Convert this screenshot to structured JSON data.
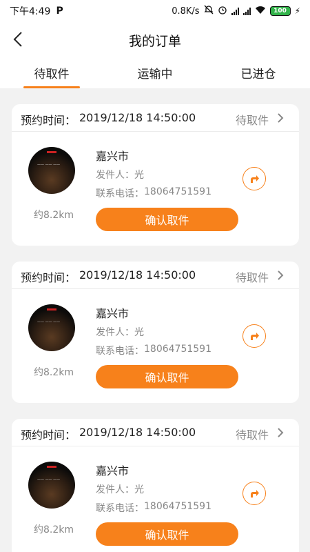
{
  "status_bar": {
    "time": "下午4:49",
    "p_icon": "P",
    "speed": "0.8K/s",
    "battery": "100",
    "icons": [
      "alarm-mute-icon",
      "alarm-icon",
      "signal-icon",
      "signal-icon",
      "wifi-icon",
      "battery-icon",
      "charging-icon"
    ]
  },
  "header": {
    "title": "我的订单",
    "back_icon": "back-arrow-icon"
  },
  "tabs": [
    {
      "label": "待取件",
      "active": true
    },
    {
      "label": "运输中",
      "active": false
    },
    {
      "label": "已进仓",
      "active": false
    }
  ],
  "orders": [
    {
      "appt_label": "预约时间：",
      "appt_time": "2019/12/18 14:50:00",
      "status": "待取件",
      "city": "嘉兴市",
      "sender_label": "发件人：",
      "sender": "光",
      "phone_label": "联系电话：",
      "phone": "18064751591",
      "distance": "约8.2km",
      "confirm_label": "确认取件"
    },
    {
      "appt_label": "预约时间：",
      "appt_time": "2019/12/18 14:50:00",
      "status": "待取件",
      "city": "嘉兴市",
      "sender_label": "发件人：",
      "sender": "光",
      "phone_label": "联系电话：",
      "phone": "18064751591",
      "distance": "约8.2km",
      "confirm_label": "确认取件"
    },
    {
      "appt_label": "预约时间：",
      "appt_time": "2019/12/18 14:50:00",
      "status": "待取件",
      "city": "嘉兴市",
      "sender_label": "发件人：",
      "sender": "光",
      "phone_label": "联系电话：",
      "phone": "18064751591",
      "distance": "约8.2km",
      "confirm_label": "确认取件"
    }
  ],
  "colors": {
    "accent": "#f7811b",
    "background": "#f2f2f2",
    "muted_text": "#888888"
  }
}
